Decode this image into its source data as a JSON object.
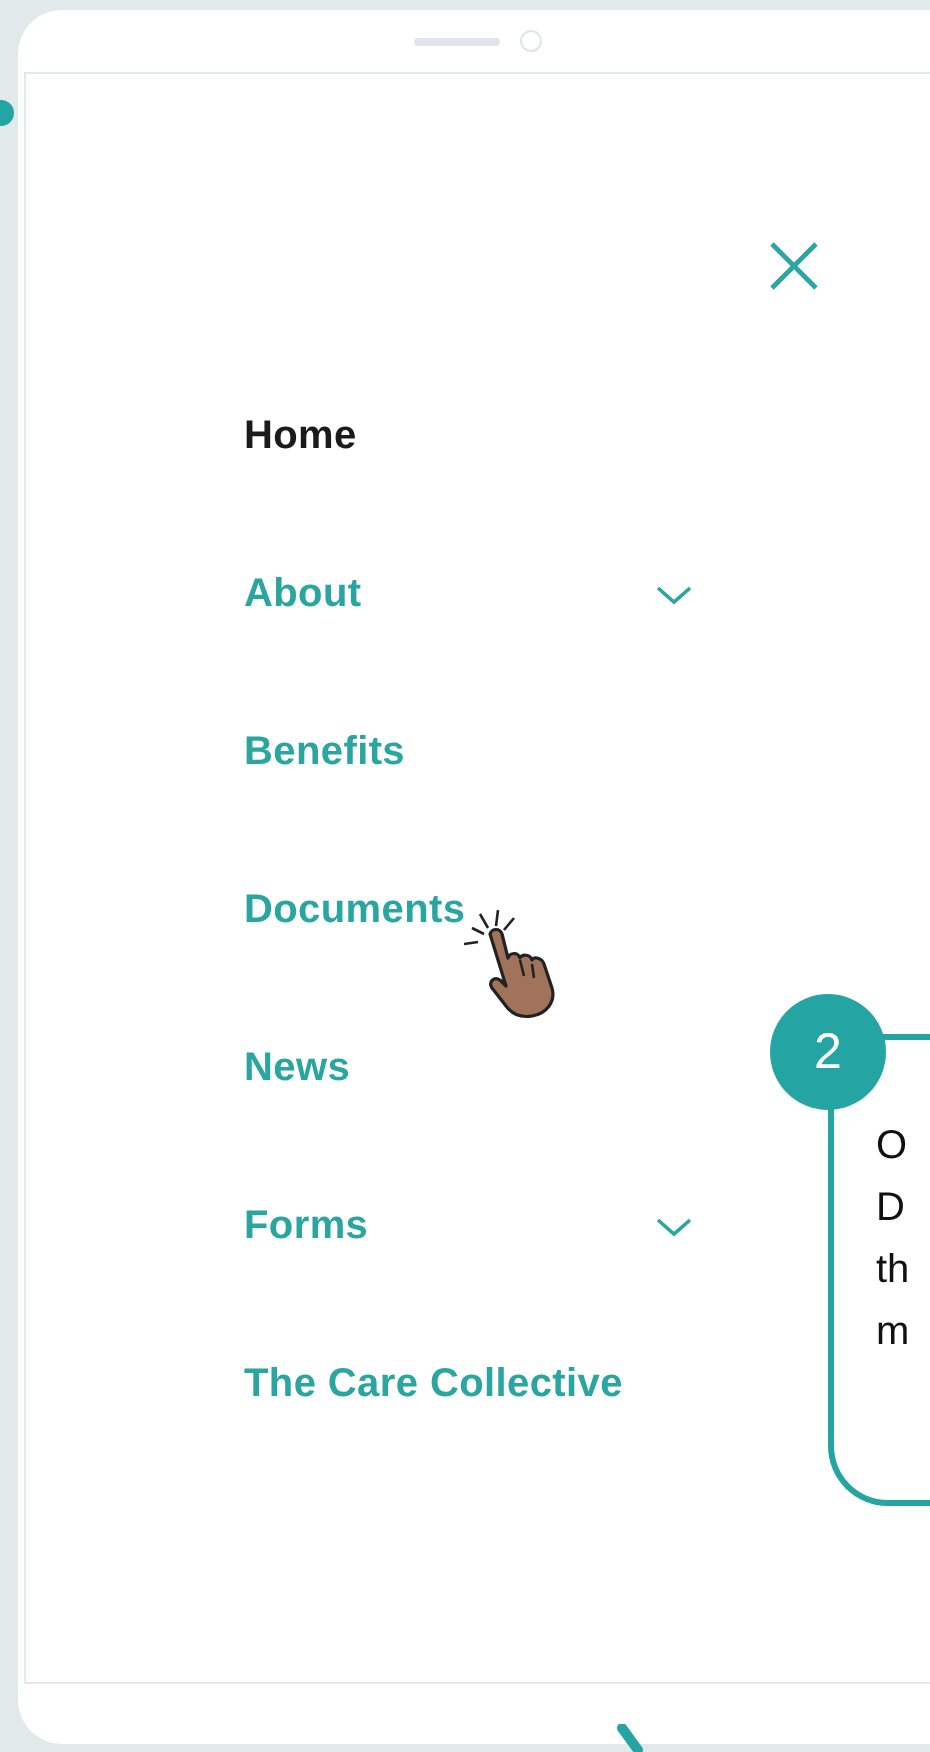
{
  "menu": {
    "items": [
      {
        "label": "Home",
        "selected": true,
        "has_submenu": false
      },
      {
        "label": "About",
        "selected": false,
        "has_submenu": true
      },
      {
        "label": "Benefits",
        "selected": false,
        "has_submenu": false
      },
      {
        "label": "Documents",
        "selected": false,
        "has_submenu": false
      },
      {
        "label": "News",
        "selected": false,
        "has_submenu": false
      },
      {
        "label": "Forms",
        "selected": false,
        "has_submenu": true
      },
      {
        "label": "The Care Collective",
        "selected": false,
        "has_submenu": false
      }
    ]
  },
  "callout": {
    "number": "2",
    "lines": [
      "O",
      "D",
      "th",
      "m"
    ]
  }
}
